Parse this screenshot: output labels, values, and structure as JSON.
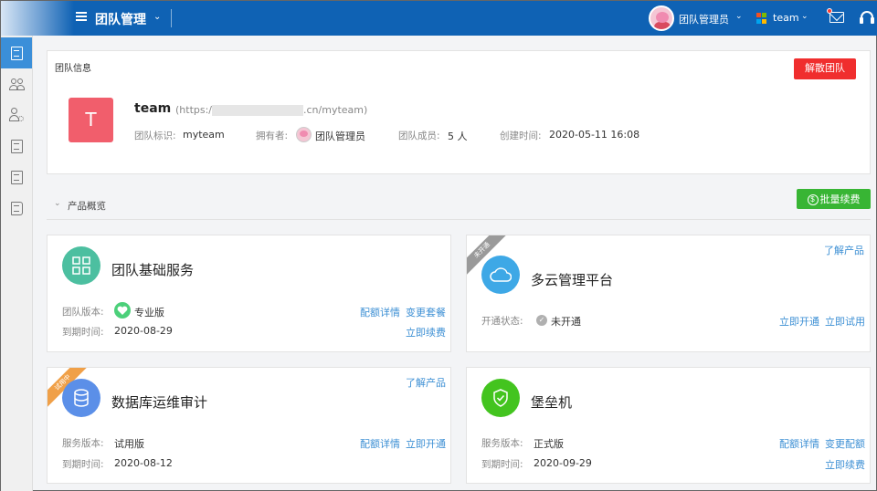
{
  "topbar": {
    "title": "团队管理",
    "user_name": "团队管理员",
    "team_name": "team",
    "team_logo_colors": [
      "#f25022",
      "#7fba00",
      "#00a4ef",
      "#ffb900"
    ]
  },
  "sidebar": {
    "items": [
      {
        "icon": "document-icon",
        "active": true
      },
      {
        "icon": "people-icon",
        "active": false
      },
      {
        "icon": "user-settings-icon",
        "active": false
      },
      {
        "icon": "document-settings-icon",
        "active": false
      },
      {
        "icon": "clipboard-icon",
        "active": false
      },
      {
        "icon": "book-icon",
        "active": false
      }
    ]
  },
  "team_info": {
    "section_label": "团队信息",
    "dissolve_label": "解散团队",
    "avatar_letter": "T",
    "name": "team",
    "url_prefix": "(https:/",
    "url_suffix": ".cn/myteam)",
    "id_label": "团队标识:",
    "id_value": "myteam",
    "owner_label": "拥有者:",
    "owner_value": "团队管理员",
    "members_label": "团队成员:",
    "members_value": "5 人",
    "created_label": "创建时间:",
    "created_value": "2020-05-11 16:08"
  },
  "overview": {
    "title": "产品概览",
    "renew_label": "批量续费"
  },
  "cards": [
    {
      "title": "团队基础服务",
      "icon_color": "#4cbfa0",
      "row1_label": "团队版本:",
      "row1_value": "专业版",
      "row2_label": "到期时间:",
      "row2_value": "2020-08-29",
      "link_a": "配额详情",
      "link_b": "变更套餐",
      "link_c": "立即续费"
    },
    {
      "title": "多云管理平台",
      "icon_color": "#3ea8e6",
      "ribbon": "未开通",
      "ribbon_color": "#9a9a9a",
      "top_link": "了解产品",
      "row1_label": "开通状态:",
      "row1_value": "未开通",
      "link_a": "立即开通",
      "link_b": "立即试用"
    },
    {
      "title": "数据库运维审计",
      "icon_color": "#5b8fe8",
      "ribbon": "试用中",
      "ribbon_color": "#f0a048",
      "top_link": "了解产品",
      "row1_label": "服务版本:",
      "row1_value": "试用版",
      "row2_label": "到期时间:",
      "row2_value": "2020-08-12",
      "link_a": "配额详情",
      "link_b": "立即开通"
    },
    {
      "title": "堡垒机",
      "icon_color": "#43c41f",
      "row1_label": "服务版本:",
      "row1_value": "正式版",
      "row2_label": "到期时间:",
      "row2_value": "2020-09-29",
      "link_a": "配额详情",
      "link_b": "变更配额",
      "link_c": "立即续费"
    }
  ]
}
